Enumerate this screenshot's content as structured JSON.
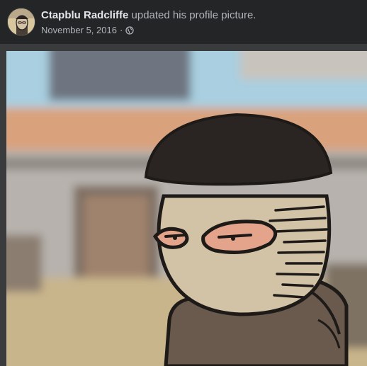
{
  "post": {
    "author_name": "Ctapblu Radcliffe",
    "action_text": " updated his profile picture.",
    "date": "November 5, 2016",
    "separator": "·",
    "audience_icon": "globe-icon"
  },
  "photo": {
    "subject": "cartoon-masked-character",
    "colors": {
      "sky": "#a9cfe0",
      "roof": "#d9a27c",
      "wall": "#b7b2ad",
      "door": "#a0836d",
      "ground": "#c9b58c",
      "beanie": "#2a2523",
      "face": "#d2c2a6",
      "eye": "#e4a48c",
      "sweater": "#6a5a4d"
    }
  }
}
